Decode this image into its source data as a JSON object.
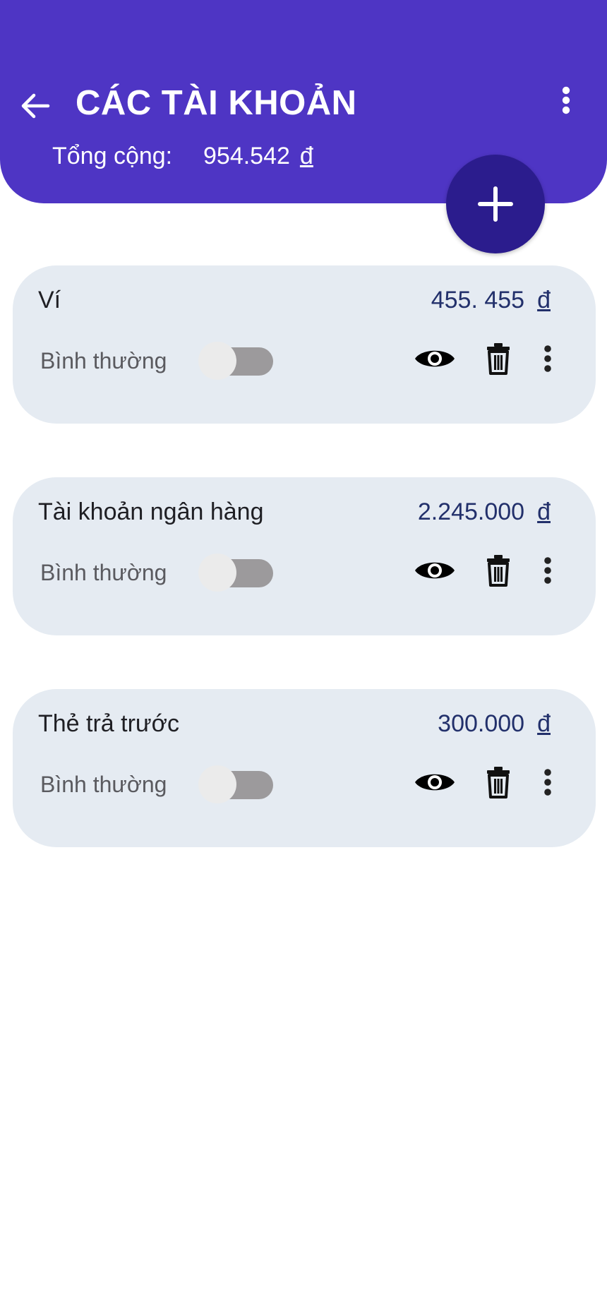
{
  "header": {
    "title": "CÁC TÀI KHOẢN",
    "total_label": "Tổng cộng:",
    "total_value": "954.542",
    "currency": "đ",
    "background_color": "#4e35c4"
  },
  "icons": {
    "back": "arrow-left-icon",
    "menu": "more-vert-icon",
    "add": "plus-icon",
    "visibility": "eye-icon",
    "delete": "trash-icon"
  },
  "fab_color": "#2b1c8d",
  "accounts": [
    {
      "name": "Ví",
      "balance": "455. 455",
      "currency": "đ",
      "mode_label": "Bình thường",
      "toggle_on": false
    },
    {
      "name": "Tài khoản ngân hàng",
      "balance": "2.245.000",
      "currency": "đ",
      "mode_label": "Bình thường",
      "toggle_on": false
    },
    {
      "name": "Thẻ trả trước",
      "balance": "300.000",
      "currency": "đ",
      "mode_label": "Bình thường",
      "toggle_on": false
    }
  ]
}
